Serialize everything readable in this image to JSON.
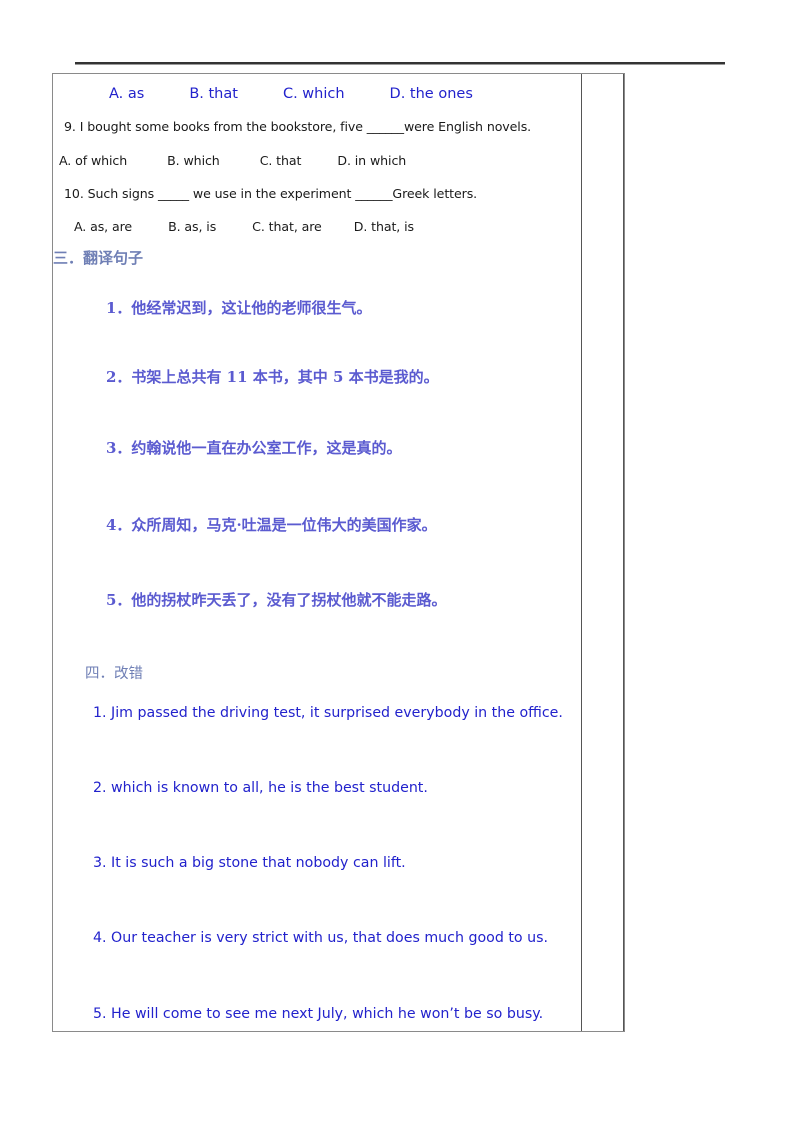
{
  "top_options": {
    "a": "A. as",
    "b": "B. that",
    "c": "C. which",
    "d": "D. the ones"
  },
  "questions": [
    {
      "stem": "9. I bought some books from the bookstore, five ______were English novels.",
      "options": {
        "a": "A. of which",
        "b": "B. which",
        "c": "C. that",
        "d": "D. in which"
      }
    },
    {
      "stem": "10. Such signs _____ we use in the experiment ______Greek letters.",
      "options": {
        "a": "A. as, are",
        "b": "B. as, is",
        "c": "C. that, are",
        "d": "D. that, is"
      }
    }
  ],
  "section_three": {
    "heading": "三．翻译句子",
    "items": [
      "1．他经常迟到，这让他的老师很生气。",
      "2．书架上总共有 11 本书，其中 5 本书是我的。",
      "3．约翰说他一直在办公室工作，这是真的。",
      "4．众所周知，马克·吐温是一位伟大的美国作家。",
      "5．他的拐杖昨天丢了，没有了拐杖他就不能走路。"
    ]
  },
  "section_four": {
    "heading": "四．改错",
    "items": [
      "1. Jim passed the driving test, it surprised everybody in the office.",
      "2. which is known to all, he is the best student.",
      "3. It is such a big stone that nobody can lift.",
      "4. Our teacher is very strict with us, that does much good to us.",
      "5. He will come to see me next July, which he won’t be so busy."
    ]
  },
  "colors": {
    "option_blue": "#2222cc",
    "chinese_blue": "#5b5bd0",
    "heading_blue": "#6f7fb5",
    "question_black": "#1a1a1a",
    "border_gray": "#8a8a8a"
  }
}
